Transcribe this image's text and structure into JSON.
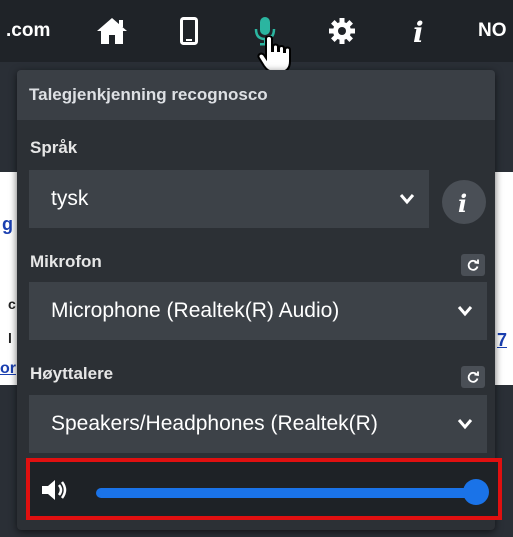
{
  "toolbar": {
    "domain_fragment": ".com",
    "right_fragment": "NO",
    "icons": [
      "home-icon",
      "mobile-icon",
      "microphone-icon",
      "gear-icon",
      "info-icon"
    ]
  },
  "page": {
    "frag1": "g",
    "frag2": "c",
    "frag3": "l",
    "frag4": "or",
    "frag5": "7"
  },
  "popup": {
    "title": "Talegjenkjenning recognosco",
    "language": {
      "label": "Språk",
      "value": "tysk"
    },
    "microphone": {
      "label": "Mikrofon",
      "value": "Microphone (Realtek(R) Audio)"
    },
    "speakers": {
      "label": "Høyttalere",
      "value": "Speakers/Headphones (Realtek(R)"
    },
    "volume": {
      "level": 1.0
    }
  },
  "colors": {
    "accent": "#1a73e8",
    "mic_active": "#2bb5a0",
    "highlight": "#e01010"
  }
}
